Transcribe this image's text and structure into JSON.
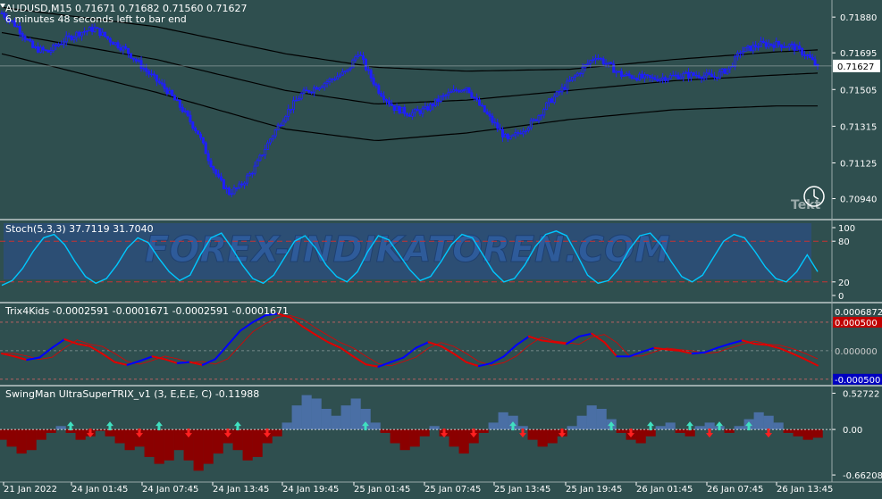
{
  "chart_data": [
    {
      "type": "candlestick",
      "title": "AUDUSD,M15  0.71671 0.71682 0.71560 0.71627",
      "subtitle": "6 minutes 48 seconds left to bar end",
      "ylim": [
        0.7085,
        0.7195
      ],
      "yticks": [
        "0.71880",
        "0.71695",
        "0.71505",
        "0.71315",
        "0.71125",
        "0.70940"
      ],
      "current_price": "0.71627",
      "close_path": [
        [
          0,
          0.719
        ],
        [
          6,
          0.7183
        ],
        [
          12,
          0.7172
        ],
        [
          18,
          0.717
        ],
        [
          24,
          0.7176
        ],
        [
          30,
          0.718
        ],
        [
          36,
          0.7182
        ],
        [
          42,
          0.7176
        ],
        [
          48,
          0.7171
        ],
        [
          56,
          0.716
        ],
        [
          64,
          0.715
        ],
        [
          70,
          0.714
        ],
        [
          76,
          0.7128
        ],
        [
          80,
          0.7115
        ],
        [
          84,
          0.7104
        ],
        [
          88,
          0.7097
        ],
        [
          92,
          0.71
        ],
        [
          98,
          0.711
        ],
        [
          104,
          0.7125
        ],
        [
          110,
          0.7138
        ],
        [
          116,
          0.7148
        ],
        [
          122,
          0.7152
        ],
        [
          128,
          0.7156
        ],
        [
          134,
          0.716
        ],
        [
          138,
          0.717
        ],
        [
          142,
          0.7159
        ],
        [
          146,
          0.715
        ],
        [
          152,
          0.7141
        ],
        [
          158,
          0.7138
        ],
        [
          164,
          0.714
        ],
        [
          170,
          0.7146
        ],
        [
          176,
          0.715
        ],
        [
          180,
          0.7152
        ],
        [
          184,
          0.7144
        ],
        [
          190,
          0.7134
        ],
        [
          196,
          0.7124
        ],
        [
          200,
          0.7128
        ],
        [
          206,
          0.7134
        ],
        [
          212,
          0.7144
        ],
        [
          218,
          0.7152
        ],
        [
          224,
          0.716
        ],
        [
          230,
          0.7168
        ],
        [
          236,
          0.7162
        ],
        [
          240,
          0.7158
        ],
        [
          246,
          0.7157
        ],
        [
          252,
          0.7156
        ],
        [
          258,
          0.7157
        ],
        [
          264,
          0.7158
        ],
        [
          270,
          0.7158
        ],
        [
          276,
          0.7157
        ],
        [
          282,
          0.7162
        ],
        [
          286,
          0.717
        ],
        [
          290,
          0.7172
        ],
        [
          294,
          0.7174
        ],
        [
          300,
          0.7174
        ],
        [
          306,
          0.7173
        ],
        [
          312,
          0.7168
        ],
        [
          316,
          0.7162
        ]
      ],
      "bands": [
        {
          "name": "",
          "values": [
            [
              0,
              0.7193
            ],
            [
              60,
              0.7183
            ],
            [
              110,
              0.7169
            ],
            [
              145,
              0.7162
            ],
            [
              180,
              0.716
            ],
            [
              220,
              0.7161
            ],
            [
              260,
              0.7166
            ],
            [
              300,
              0.717
            ],
            [
              316,
              0.7171
            ]
          ]
        },
        {
          "name": "",
          "values": [
            [
              0,
              0.718
            ],
            [
              60,
              0.7166
            ],
            [
              110,
              0.715
            ],
            [
              145,
              0.7143
            ],
            [
              180,
              0.7145
            ],
            [
              220,
              0.715
            ],
            [
              260,
              0.7155
            ],
            [
              300,
              0.7158
            ],
            [
              316,
              0.7159
            ]
          ]
        },
        {
          "name": "",
          "values": [
            [
              0,
              0.7169
            ],
            [
              60,
              0.7149
            ],
            [
              110,
              0.713
            ],
            [
              145,
              0.7124
            ],
            [
              180,
              0.7128
            ],
            [
              220,
              0.7135
            ],
            [
              260,
              0.714
            ],
            [
              300,
              0.7142
            ],
            [
              316,
              0.7142
            ]
          ]
        }
      ]
    },
    {
      "type": "line",
      "title": "Stoch(5,3,3) 37.7119 31.7040",
      "ylim": [
        0,
        100
      ],
      "yticks": [
        "100",
        "80",
        "20",
        "0"
      ],
      "levels": [
        80,
        20
      ],
      "values": [
        15,
        22,
        40,
        65,
        85,
        90,
        75,
        50,
        28,
        18,
        25,
        45,
        70,
        85,
        78,
        55,
        35,
        22,
        30,
        60,
        85,
        92,
        70,
        45,
        25,
        18,
        30,
        55,
        80,
        88,
        70,
        45,
        28,
        20,
        35,
        65,
        88,
        82,
        60,
        38,
        22,
        28,
        50,
        75,
        90,
        85,
        60,
        35,
        20,
        25,
        45,
        72,
        90,
        95,
        88,
        60,
        30,
        18,
        22,
        40,
        68,
        88,
        92,
        75,
        50,
        28,
        20,
        30,
        55,
        80,
        90,
        85,
        65,
        42,
        25,
        20,
        35,
        60,
        35
      ]
    },
    {
      "type": "line",
      "title": "Trix4Kids -0.0002591 -0.0001671 -0.0002591 -0.0001671",
      "ylim": [
        -0.00055,
        0.00075
      ],
      "yticks": [
        "0.0006872",
        "0.000500",
        "0.000000",
        "-0.000500"
      ],
      "values": [
        -5e-05,
        -0.0001,
        -0.00016,
        -0.00012,
        5e-05,
        0.0002,
        0.00012,
        8e-05,
        -5e-05,
        -0.0002,
        -0.00025,
        -0.00018,
        -0.0001,
        -0.00015,
        -0.00022,
        -0.0002,
        -0.00025,
        -0.00015,
        0.0001,
        0.00035,
        0.0005,
        0.00062,
        0.00065,
        0.00058,
        0.00042,
        0.00028,
        0.00015,
        5e-05,
        -0.0001,
        -0.00024,
        -0.00028,
        -0.0002,
        -0.00012,
        5e-05,
        0.00015,
        8e-05,
        -5e-05,
        -0.0002,
        -0.00027,
        -0.00022,
        -0.0001,
        0.0001,
        0.00025,
        0.00018,
        0.00015,
        0.00012,
        0.00025,
        0.0003,
        0.00015,
        -0.0001,
        -0.0001,
        -2e-05,
        5e-05,
        2e-05,
        0.0,
        -5e-05,
        -3e-05,
        5e-05,
        0.00012,
        0.00018,
        0.00012,
        0.0001,
        4e-05,
        -5e-05,
        -0.00015,
        -0.00026
      ]
    },
    {
      "type": "histogram",
      "title": "SwingMan UltraSuperTRIX_v1 (3, E,E,E, C) -0.11988",
      "ylim": [
        -0.7,
        0.56
      ],
      "yticks": [
        "0.52722",
        "0.00",
        "-0.66208"
      ],
      "values": [
        -0.15,
        -0.25,
        -0.35,
        -0.3,
        -0.15,
        -0.05,
        0.05,
        -0.05,
        -0.15,
        -0.1,
        -0.02,
        -0.1,
        -0.2,
        -0.3,
        -0.25,
        -0.4,
        -0.5,
        -0.45,
        -0.3,
        -0.45,
        -0.6,
        -0.5,
        -0.35,
        -0.2,
        -0.3,
        -0.45,
        -0.4,
        -0.2,
        -0.1,
        0.1,
        0.35,
        0.5,
        0.45,
        0.3,
        0.2,
        0.35,
        0.45,
        0.3,
        0.1,
        -0.05,
        -0.2,
        -0.3,
        -0.25,
        -0.1,
        0.05,
        -0.1,
        -0.25,
        -0.35,
        -0.2,
        -0.05,
        0.1,
        0.25,
        0.2,
        0.05,
        -0.15,
        -0.25,
        -0.2,
        -0.1,
        0.05,
        0.2,
        0.35,
        0.3,
        0.15,
        -0.05,
        -0.15,
        -0.2,
        -0.1,
        0.05,
        0.1,
        -0.05,
        -0.1,
        0.05,
        0.1,
        0.05,
        -0.05,
        0.05,
        0.15,
        0.25,
        0.2,
        0.1,
        -0.05,
        -0.1,
        -0.15,
        -0.12
      ],
      "arrows_up": [
        7,
        11,
        16,
        24,
        37,
        52,
        62,
        66,
        70,
        73,
        76
      ],
      "arrows_down": [
        9,
        14,
        19,
        23,
        27,
        45,
        48,
        53,
        57,
        64,
        72,
        78
      ]
    }
  ],
  "xlabels": [
    "21 Jan 2022",
    "24 Jan 01:45",
    "24 Jan 07:45",
    "24 Jan 13:45",
    "24 Jan 19:45",
    "25 Jan 01:45",
    "25 Jan 07:45",
    "25 Jan 13:45",
    "25 Jan 19:45",
    "26 Jan 01:45",
    "26 Jan 07:45",
    "26 Jan 13:45"
  ],
  "watermark": "FOREX-INDIKATOREN.COM",
  "logo_text": "Tekt",
  "colors": {
    "background": "#2f4f4f",
    "bull": "#1e1eff",
    "bear": "#1e1eff",
    "band": "#000000",
    "stoch": "#00c8ff",
    "level": "#c83232",
    "trix_blue": "#0000ff",
    "trix_red": "#e00000",
    "hist_up": "#4a6fa5",
    "hist_down": "#8b0000",
    "arrow_up": "#40e0c0",
    "arrow_down": "#ff2020",
    "text": "#ffffff",
    "price_tag": "#ffffff",
    "trix_red_tag": "#c00000",
    "trix_blue_tag": "#0000c0"
  }
}
